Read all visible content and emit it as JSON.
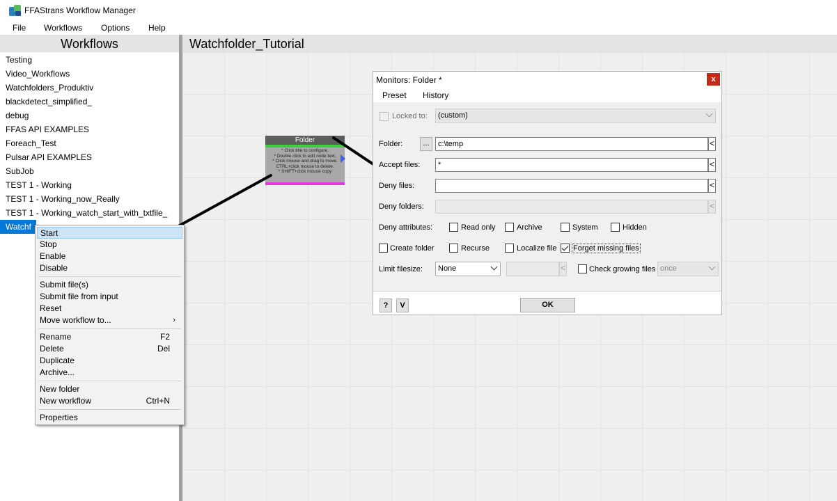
{
  "window": {
    "title": "FFAStrans Workflow Manager"
  },
  "menu": [
    "File",
    "Workflows",
    "Options",
    "Help"
  ],
  "left_panel": {
    "header": "Workflows",
    "workflows": [
      "Testing",
      "Video_Workflows",
      "Watchfolders_Produktiv",
      "blackdetect_simplified_",
      "debug",
      "FFAS API EXAMPLES",
      "Foreach_Test",
      "Pulsar API EXAMPLES",
      "SubJob",
      "TEST 1 - Working",
      "TEST 1 - Working_now_Really",
      "TEST 1 - Working_watch_start_with_txtfile_"
    ],
    "selected_visible": "Watchf"
  },
  "canvas": {
    "title": "Watchfolder_Tutorial",
    "node": {
      "title": "Folder",
      "help": [
        "* Click title to configure.",
        "* Double click to edit node text.",
        "* Click mouse and drag to move.",
        "CTRL+click mouse to delete.",
        "* SHIFT+click mouse copy"
      ]
    }
  },
  "context_menu": {
    "items": [
      {
        "label": "Start",
        "shortcut": ""
      },
      {
        "label": "Stop",
        "shortcut": ""
      },
      {
        "label": "Enable",
        "shortcut": ""
      },
      {
        "label": "Disable",
        "shortcut": ""
      },
      {
        "label": "Submit file(s)",
        "shortcut": ""
      },
      {
        "label": "Submit file from input",
        "shortcut": ""
      },
      {
        "label": "Reset",
        "shortcut": ""
      },
      {
        "label": "Move workflow to...",
        "shortcut": ""
      },
      {
        "label": "Rename",
        "shortcut": "F2"
      },
      {
        "label": "Delete",
        "shortcut": "Del"
      },
      {
        "label": "Duplicate",
        "shortcut": ""
      },
      {
        "label": "Archive...",
        "shortcut": ""
      },
      {
        "label": "New folder",
        "shortcut": ""
      },
      {
        "label": "New workflow",
        "shortcut": "Ctrl+N"
      },
      {
        "label": "Properties",
        "shortcut": ""
      }
    ],
    "highlighted": "Start"
  },
  "dialog": {
    "title": "Monitors: Folder *",
    "close": "x",
    "menu": [
      "Preset",
      "History"
    ],
    "locked_to_label": "Locked to:",
    "locked_to_value": "(custom)",
    "folder_label": "Folder:",
    "browse_label": "...",
    "folder_value": "c:\\temp",
    "accept_label": "Accept files:",
    "accept_value": "*",
    "deny_files_label": "Deny files:",
    "deny_files_value": "",
    "deny_folders_label": "Deny folders:",
    "deny_folders_value": "",
    "side_arrow": "<",
    "deny_attributes_label": "Deny attributes:",
    "attributes": [
      {
        "label": "Read only",
        "checked": false
      },
      {
        "label": "Archive",
        "checked": false
      },
      {
        "label": "System",
        "checked": false
      },
      {
        "label": "Hidden",
        "checked": false
      }
    ],
    "options": [
      {
        "label": "Create folder",
        "checked": false
      },
      {
        "label": "Recurse",
        "checked": false
      },
      {
        "label": "Localize file",
        "checked": false
      },
      {
        "label": "Forget missing files",
        "checked": true
      }
    ],
    "limit_label": "Limit filesize:",
    "limit_value": "None",
    "limit_amount": "",
    "check_growing_label": "Check growing files",
    "check_growing_checked": false,
    "check_growing_value": "once",
    "help_button": "?",
    "v_button": "V",
    "ok_button": "OK"
  }
}
